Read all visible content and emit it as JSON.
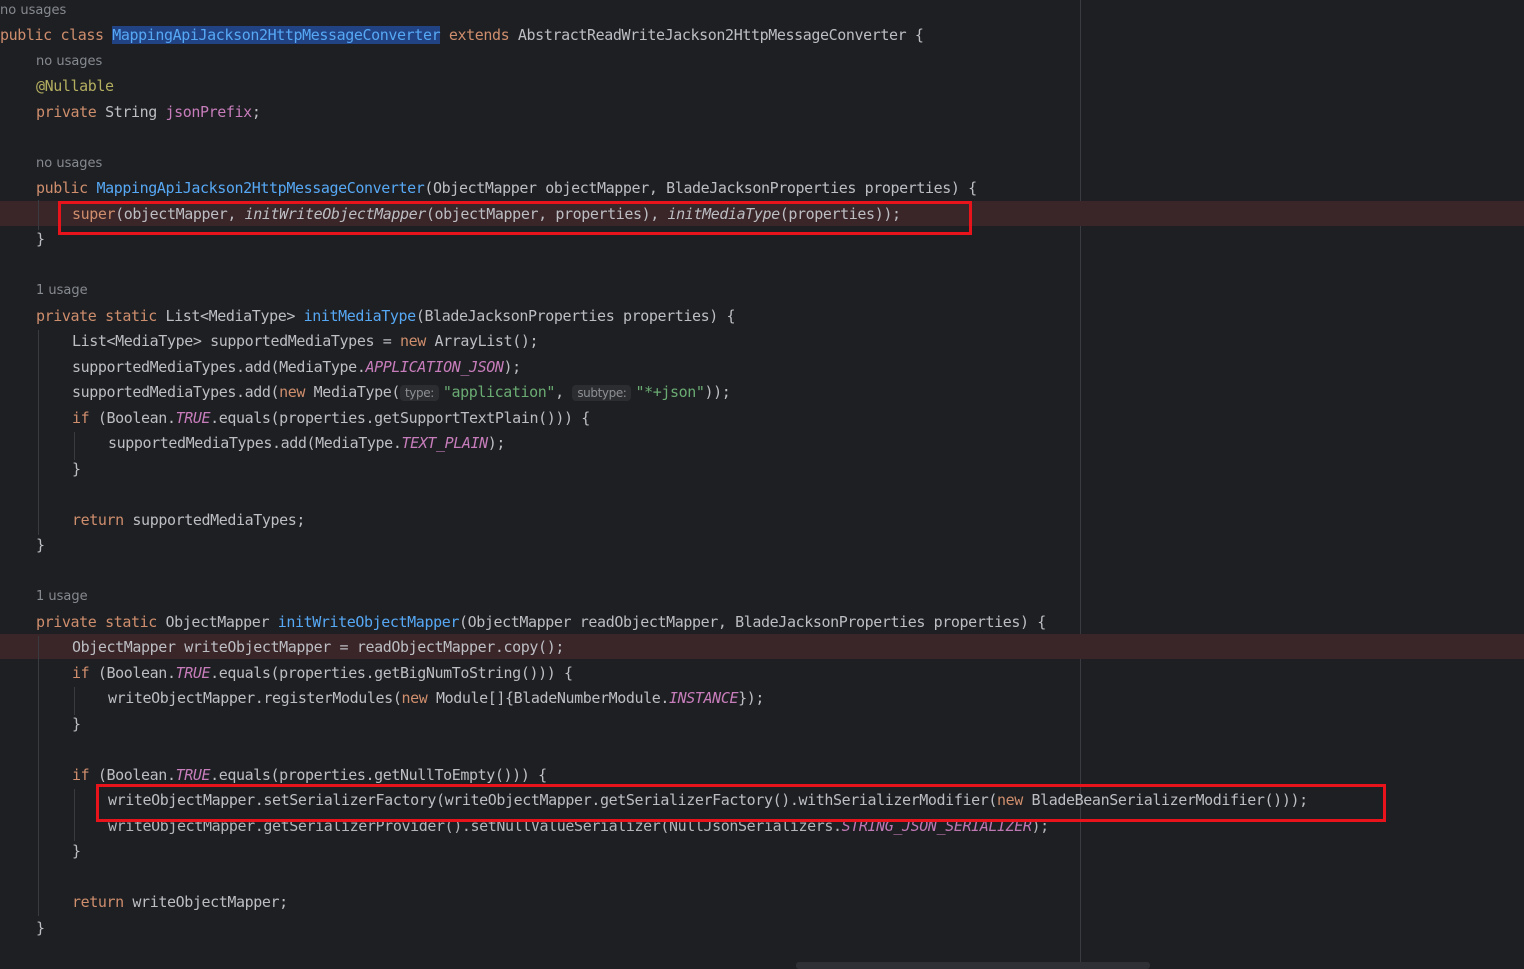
{
  "hints": {
    "class_usages": "no usages",
    "field_usages": "no usages",
    "ctor_usages": "no usages",
    "media_usages": "1 usage",
    "writer_usages": "1 usage"
  },
  "code": {
    "l1": {
      "kw1": "public",
      "kw2": "class",
      "cls": "MappingApiJackson2HttpMessageConverter",
      "kw3": "extends",
      "rest": "AbstractReadWriteJackson2HttpMessageConverter {"
    },
    "l2": {
      "ann": "@Nullable"
    },
    "l3": {
      "kw": "private",
      "type": "String",
      "field": "jsonPrefix",
      "end": ";"
    },
    "l4": {
      "kw": "public",
      "fn": "MappingApiJackson2HttpMessageConverter",
      "rest": "(ObjectMapper objectMapper, BladeJacksonProperties properties) {"
    },
    "l5": {
      "kw": "super",
      "a": "(objectMapper, ",
      "m1": "initWriteObjectMapper",
      "b": "(objectMapper, properties), ",
      "m2": "initMediaType",
      "c": "(properties));"
    },
    "l6": {
      "text": "}"
    },
    "l7": {
      "kw1": "private",
      "kw2": "static",
      "type": "List<MediaType>",
      "fn": "initMediaType",
      "rest": "(BladeJacksonProperties properties) {"
    },
    "l8": {
      "a": "List<MediaType> supportedMediaTypes = ",
      "kw": "new",
      "b": " ArrayList();"
    },
    "l9": {
      "a": "supportedMediaTypes.add(MediaType.",
      "const": "APPLICATION_JSON",
      "b": ");"
    },
    "l10": {
      "a": "supportedMediaTypes.add(",
      "kw": "new",
      "b": " MediaType(",
      "hint1": "type:",
      "s1": "\"application\"",
      "c": ", ",
      "hint2": "subtype:",
      "s2": "\"*+json\"",
      "d": "));"
    },
    "l11": {
      "kw": "if",
      "a": " (Boolean.",
      "const": "TRUE",
      "b": ".equals(properties.getSupportTextPlain())) {"
    },
    "l12": {
      "a": "supportedMediaTypes.add(MediaType.",
      "const": "TEXT_PLAIN",
      "b": ");"
    },
    "l13": {
      "text": "}"
    },
    "l14": {
      "kw": "return",
      "rest": " supportedMediaTypes;"
    },
    "l15": {
      "text": "}"
    },
    "l16": {
      "kw1": "private",
      "kw2": "static",
      "type": "ObjectMapper",
      "fn": "initWriteObjectMapper",
      "rest": "(ObjectMapper readObjectMapper, BladeJacksonProperties properties) {"
    },
    "l17": {
      "text": "ObjectMapper writeObjectMapper = readObjectMapper.copy();"
    },
    "l18": {
      "kw": "if",
      "a": " (Boolean.",
      "const": "TRUE",
      "b": ".equals(properties.getBigNumToString())) {"
    },
    "l19": {
      "a": "writeObjectMapper.registerModules(",
      "kw": "new",
      "b": " Module[]{BladeNumberModule.",
      "const": "INSTANCE",
      "c": "});"
    },
    "l20": {
      "text": "}"
    },
    "l21": {
      "kw": "if",
      "a": " (Boolean.",
      "const": "TRUE",
      "b": ".equals(properties.getNullToEmpty())) {"
    },
    "l22": {
      "a": "writeObjectMapper.setSerializerFactory(writeObjectMapper.getSerializerFactory().withSerializerModifier(",
      "kw": "new",
      "b": " BladeBeanSerializerModifier()));"
    },
    "l23": {
      "a": "writeObjectMapper.getSerializerProvider().setNullValueSerializer(NullJsonSerializers.",
      "const": "STRING_JSON_SERIALIZER",
      "b": ");"
    },
    "l24": {
      "text": "}"
    },
    "l25": {
      "kw": "return",
      "rest": " writeObjectMapper;"
    },
    "l26": {
      "text": "}"
    }
  },
  "colors": {
    "background": "#1e1f22",
    "keyword": "#cf8e6d",
    "function": "#56a8f5",
    "field": "#c77dbb",
    "string": "#6aab73",
    "annotation": "#b3ae60",
    "breakpoint_line": "#3a2628",
    "highlight_box": "#e8131b"
  }
}
